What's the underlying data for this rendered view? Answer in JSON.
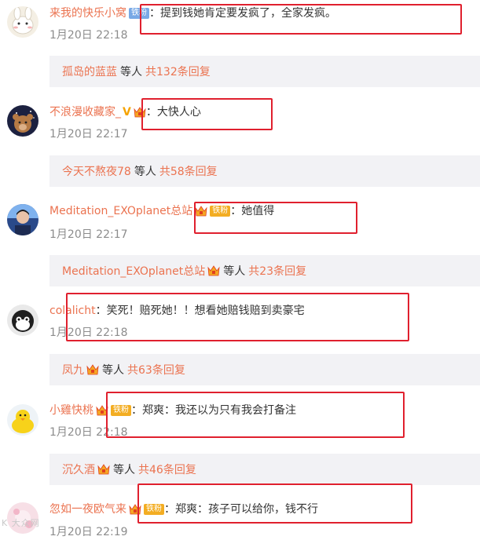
{
  "colors": {
    "username": "#eb7350",
    "reply_bg": "#f2f2f5",
    "highlight_box": "#e0202e",
    "time": "#8c8c8c",
    "tag_blue": "#78a9e6",
    "tag_gold": "#f3ad22"
  },
  "comments": [
    {
      "user": "来我的快乐小窝",
      "tag": "铁粉",
      "sep": "：",
      "text": "提到钱她肯定要发疯了，全家发疯。",
      "time": "1月20日 22:18",
      "reply": {
        "who": "孤岛的蓝蓝",
        "mid": "等人",
        "count": "共132条回复"
      }
    },
    {
      "user": "不浪漫收藏家_",
      "vbadge": "V",
      "sep": "：",
      "text": "大快人心",
      "time": "1月20日 22:17",
      "reply": {
        "who": "今天不熬夜78",
        "mid": "等人",
        "count": "共58条回复"
      }
    },
    {
      "user": "Meditation_EXOplanet总站",
      "tag": "铁粉",
      "sep": "：",
      "text": "她值得",
      "time": "1月20日 22:17",
      "reply": {
        "who": "Meditation_EXOplanet总站",
        "mid": "等人",
        "count": "共23条回复"
      }
    },
    {
      "user": "colalicht",
      "sep": "：",
      "text": "笑死！赔死她！！想看她赔钱赔到卖豪宅",
      "time": "1月20日 22:18",
      "reply": {
        "who": "凤九",
        "mid": "等人",
        "count": "共63条回复"
      }
    },
    {
      "user": "小雞快桃",
      "tag": "铁粉",
      "sep": "：",
      "text": "郑爽：我还以为只有我会打备注",
      "time": "1月20日 22:18",
      "reply": {
        "who": "沉久酒",
        "mid": "等人",
        "count": "共46条回复"
      }
    },
    {
      "user": "忽如一夜欧气来",
      "tag": "铁粉",
      "sep": "：",
      "text": "郑爽：孩子可以给你，钱不行",
      "time": "1月20日 22:19"
    }
  ],
  "watermark": "K 大众网"
}
